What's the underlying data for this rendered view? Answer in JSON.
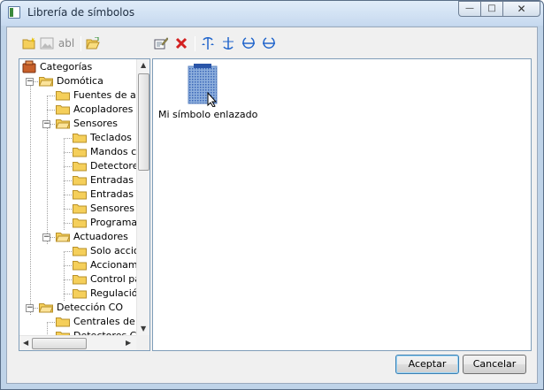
{
  "window": {
    "title": "Librería de símbolos"
  },
  "tree": {
    "root": "Categorías",
    "items": [
      {
        "label": "Domótica",
        "level": 1,
        "expanded": true
      },
      {
        "label": "Fuentes de ali",
        "level": 2
      },
      {
        "label": "Acopladores y",
        "level": 2
      },
      {
        "label": "Sensores",
        "level": 2,
        "expanded": true
      },
      {
        "label": "Teclados",
        "level": 3
      },
      {
        "label": "Mandos c",
        "level": 3
      },
      {
        "label": "Detectore",
        "level": 3
      },
      {
        "label": "Entradas b",
        "level": 3
      },
      {
        "label": "Entradas a",
        "level": 3
      },
      {
        "label": "Sensores",
        "level": 3
      },
      {
        "label": "Programad",
        "level": 3
      },
      {
        "label": "Actuadores",
        "level": 2,
        "expanded": true
      },
      {
        "label": "Solo accio",
        "level": 3
      },
      {
        "label": "Accionam",
        "level": 3
      },
      {
        "label": "Control pa",
        "level": 3
      },
      {
        "label": "Regulació",
        "level": 3
      },
      {
        "label": "Detección CO",
        "level": 1,
        "expanded": true
      },
      {
        "label": "Centrales de c",
        "level": 2
      },
      {
        "label": "Detectores CO",
        "level": 2
      }
    ]
  },
  "content": {
    "symbol_label": "Mi símbolo enlazado"
  },
  "buttons": {
    "accept": "Aceptar",
    "cancel": "Cancelar"
  },
  "title_buttons": {
    "minimize": "—",
    "maximize": "□",
    "close": "✕"
  },
  "toolbar_text": {
    "abl": "abl"
  },
  "colors": {
    "accent": "#3c7fb1",
    "folder": "#f5cf5a",
    "delete_red": "#d32020",
    "rotate_blue": "#2266cc"
  }
}
